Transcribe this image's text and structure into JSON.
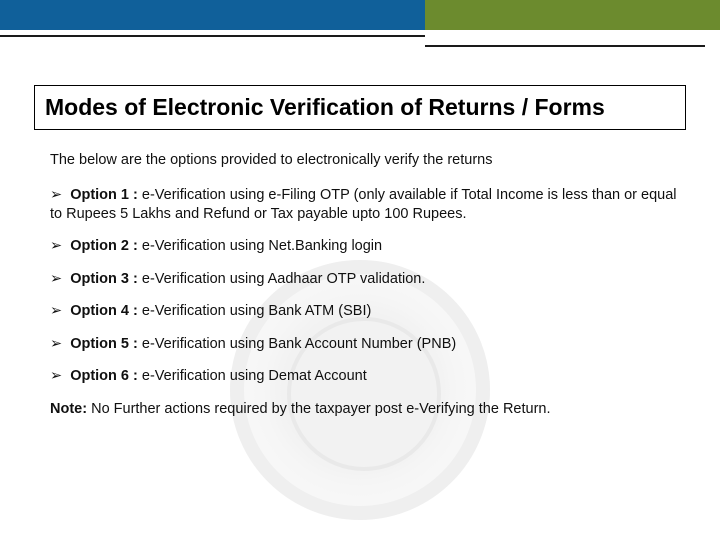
{
  "title": "Modes of Electronic Verification of Returns / Forms",
  "intro": "The below are the options provided to electronically verify the returns",
  "options": [
    {
      "label": "Option 1 :",
      "text": " e-Verification using e-Filing OTP (only available if Total Income is less than or equal to Rupees 5 Lakhs and Refund or Tax payable upto 100 Rupees."
    },
    {
      "label": "Option 2 :",
      "text": " e-Verification using Net.Banking login"
    },
    {
      "label": "Option 3 :",
      "text": " e-Verification using Aadhaar OTP validation."
    },
    {
      "label": "Option 4 :",
      "text": " e-Verification using Bank ATM (SBI)"
    },
    {
      "label": "Option 5 :",
      "text": " e-Verification using Bank Account Number (PNB)"
    },
    {
      "label": "Option 6 :",
      "text": " e-Verification using Demat Account"
    }
  ],
  "note": {
    "label": "Note:",
    "text": " No Further actions required by the taxpayer post e-Verifying the Return."
  },
  "bullet": "➢"
}
